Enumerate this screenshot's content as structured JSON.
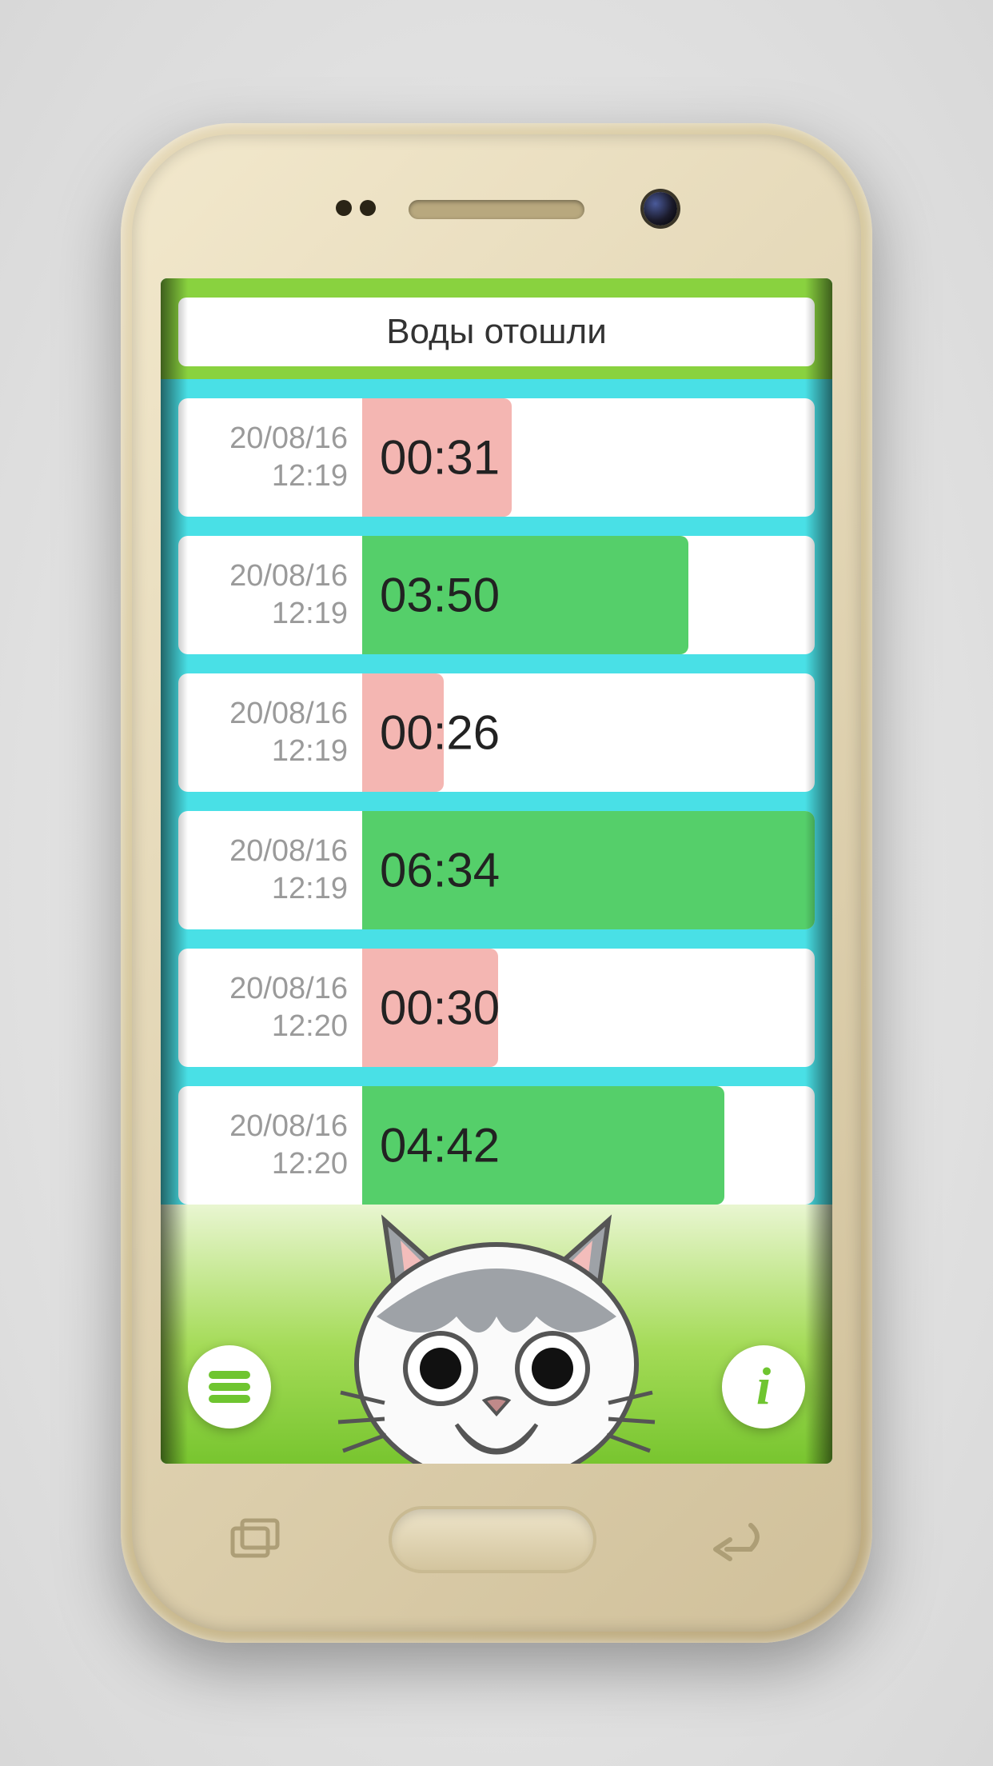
{
  "header": {
    "title": "Воды отошли"
  },
  "rows": [
    {
      "date": "20/08/16",
      "time": "12:19",
      "duration": "00:31",
      "kind": "pink",
      "width_pct": 33
    },
    {
      "date": "20/08/16",
      "time": "12:19",
      "duration": "03:50",
      "kind": "green",
      "width_pct": 72
    },
    {
      "date": "20/08/16",
      "time": "12:19",
      "duration": "00:26",
      "kind": "pink",
      "width_pct": 18
    },
    {
      "date": "20/08/16",
      "time": "12:19",
      "duration": "06:34",
      "kind": "green",
      "width_pct": 100
    },
    {
      "date": "20/08/16",
      "time": "12:20",
      "duration": "00:30",
      "kind": "pink",
      "width_pct": 30
    },
    {
      "date": "20/08/16",
      "time": "12:20",
      "duration": "04:42",
      "kind": "green",
      "width_pct": 80
    }
  ],
  "footer": {
    "menu_label": "menu",
    "info_label": "info"
  },
  "colors": {
    "pink": "#f4b6b2",
    "green": "#55cf6a"
  }
}
